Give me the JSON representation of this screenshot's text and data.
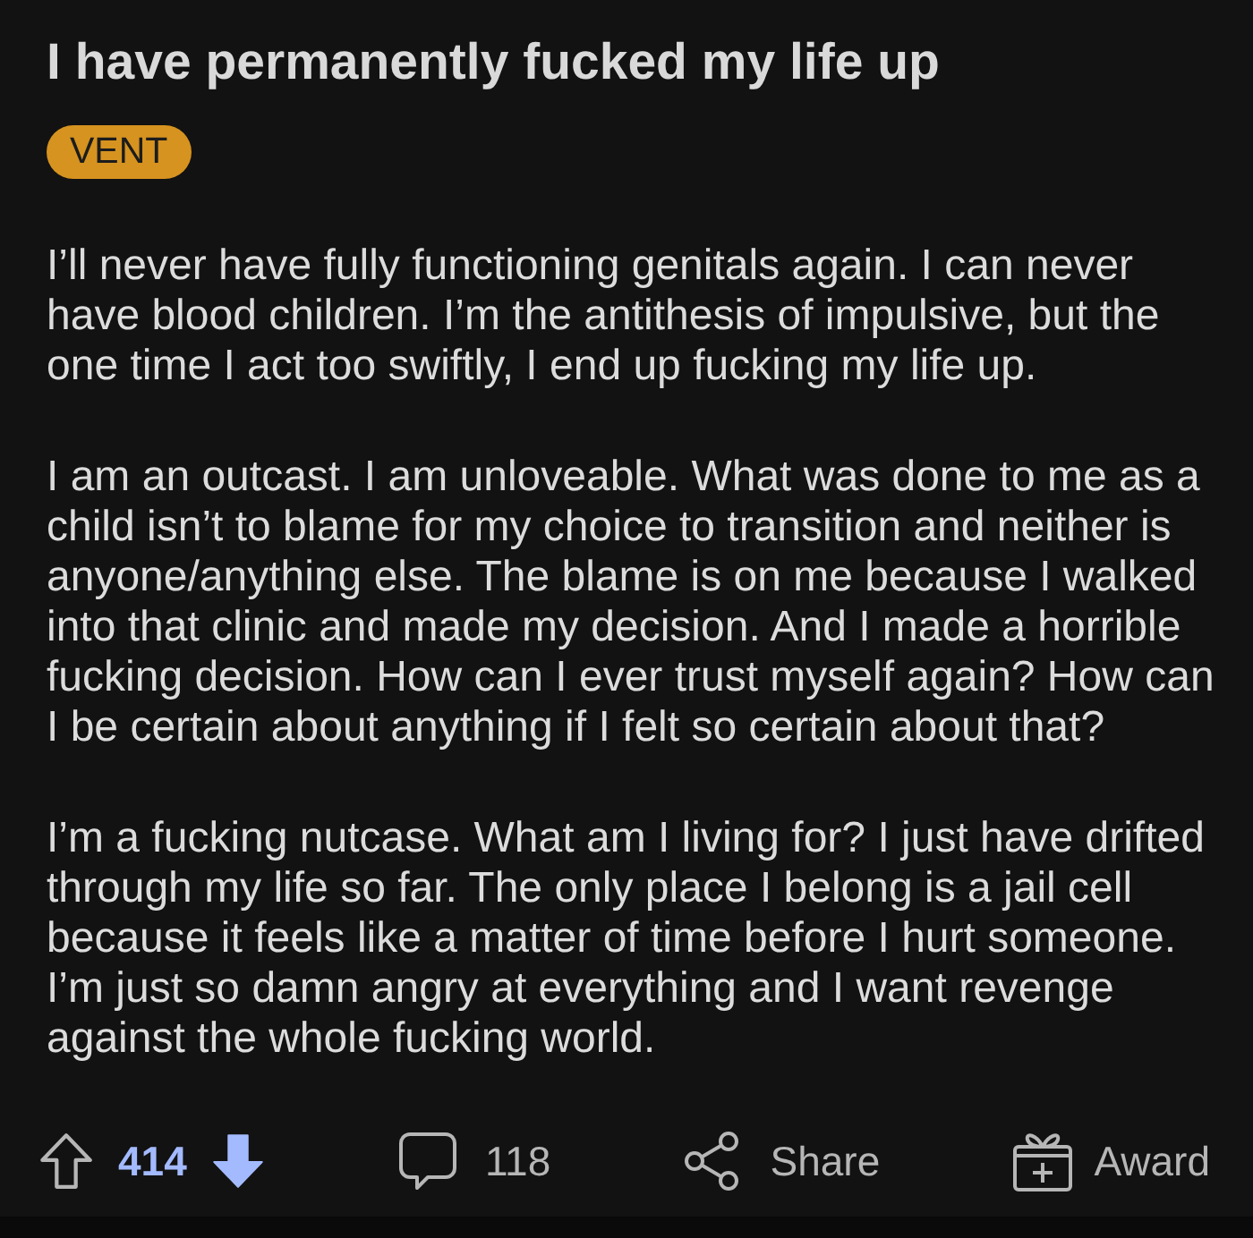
{
  "post": {
    "title": "I have permanently fucked my life up",
    "flair": "VENT",
    "body": [
      "I’ll never have fully functioning genitals again. I can never have blood children. I’m the antithesis of impulsive, but the one time I act too swiftly, I end up fucking my life up.",
      "I am an outcast. I am unloveable. What was done to me as a child isn’t to blame for my choice to transition and neither is anyone/anything else. The blame is on me because I walked into that clinic and made my decision. And I made a horrible fucking decision. How can I ever trust myself again? How can I be certain about anything if I felt so certain about that?",
      "I’m a fucking nutcase. What am I living for? I just have drifted through my life so far. The only place I belong is a jail cell because it feels like a matter of time before I hurt someone. I’m just so damn angry at everything and I want revenge against the whole fucking world."
    ],
    "actions": [
      {
        "kind": "vote",
        "score": "414",
        "upvoted": false,
        "downvoted": true
      },
      {
        "kind": "comments",
        "label": "118"
      },
      {
        "kind": "share",
        "label": "Share"
      },
      {
        "kind": "award",
        "label": "Award"
      }
    ]
  }
}
